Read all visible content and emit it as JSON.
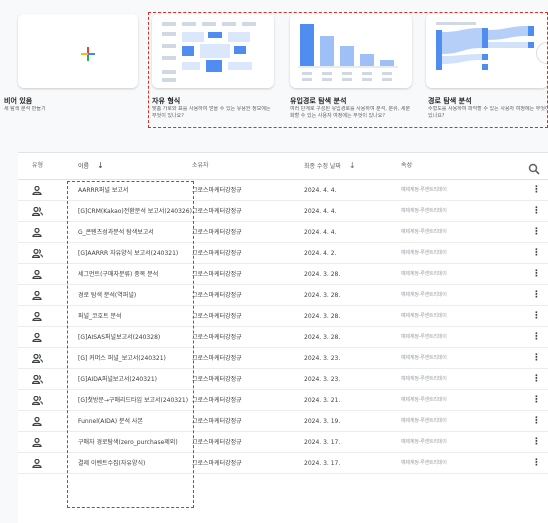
{
  "templates": [
    {
      "title": "비어 있음",
      "desc": "새 탐색 분석 만들기"
    },
    {
      "title": "자유 형식",
      "desc": "맞춤 가로와 표를 사용하여 얻을 수 있는 유용한 정보에는 무엇이 있나요?"
    },
    {
      "title": "유입경로 탐색 분석",
      "desc": "여러 단계로 구성된 유입경로를 사용하여 분석, 분류, 세분화할 수 있는 사용자 여정에는 무엇이 있나요?"
    },
    {
      "title": "경로 탐색 분석",
      "desc": "수형도를 사용하여 파악할 수 있는 사용자 여정에는 무엇이 있나요?"
    }
  ],
  "table": {
    "headers": {
      "type": "유형",
      "name": "이름",
      "owner": "소유자",
      "modified": "최종 수정 날짜",
      "property": "속성"
    },
    "sort_arrow": "↓",
    "rows": [
      {
        "icon": "person-icon",
        "name": "AARRR퍼널 보고서",
        "owner": "그로스마케터강정규",
        "date": "2024. 4. 4.",
        "property": "예제계정-루센트리데이"
      },
      {
        "icon": "people-icon",
        "name": "[G]CRM(Kakao)전환분석 보고서(240326)",
        "owner": "그로스마케터강정규",
        "date": "2024. 4. 4.",
        "property": "예제계정-루센트리데이"
      },
      {
        "icon": "person-icon",
        "name": "G_콘텐츠성과분석 탐색보고서",
        "owner": "그로스마케터강정규",
        "date": "2024. 4. 4.",
        "property": "예제계정-루센트리데이"
      },
      {
        "icon": "people-icon",
        "name": "[G]AARRR 자유양식 보고서(240321)",
        "owner": "그로스마케터강정규",
        "date": "2024. 4. 2.",
        "property": "예제계정-루센트리데이"
      },
      {
        "icon": "person-icon",
        "name": "세그먼트(구매자분류) 중복 분석",
        "owner": "그로스마케터강정규",
        "date": "2024. 3. 28.",
        "property": "예제계정-루센트리데이"
      },
      {
        "icon": "person-icon",
        "name": "경로 탐색 분석(역퍼널)",
        "owner": "그로스마케터강정규",
        "date": "2024. 3. 28.",
        "property": "예제계정-루센트리데이"
      },
      {
        "icon": "person-icon",
        "name": "퍼널_코호트 분석",
        "owner": "그로스마케터강정규",
        "date": "2024. 3. 28.",
        "property": "예제계정-루센트리데이"
      },
      {
        "icon": "person-icon",
        "name": "[G]AISAS퍼널보고서(240328)",
        "owner": "그로스마케터강정규",
        "date": "2024. 3. 28.",
        "property": "예제계정-루센트리데이"
      },
      {
        "icon": "people-icon",
        "name": "[G] 커머스 퍼널_보고서(240321)",
        "owner": "그로스마케터강정규",
        "date": "2024. 3. 23.",
        "property": "예제계정-루센트리데이"
      },
      {
        "icon": "people-icon",
        "name": "[G]AIDA퍼널보고서(240321)",
        "owner": "그로스마케터강정규",
        "date": "2024. 3. 23.",
        "property": "예제계정-루센트리데이"
      },
      {
        "icon": "people-icon",
        "name": "[G]첫방문→구매리드타임 보고서(240321)",
        "owner": "그로스마케터강정규",
        "date": "2024. 3. 21.",
        "property": "예제계정-루센트리데이"
      },
      {
        "icon": "person-icon",
        "name": "Funnel(AIDA) 분석 사본",
        "owner": "그로스마케터강정규",
        "date": "2024. 3. 19.",
        "property": "예제계정-루센트리데이"
      },
      {
        "icon": "person-icon",
        "name": "구매자 경로탐색(zero_purchase제외)",
        "owner": "그로스마케터강정규",
        "date": "2024. 3. 17.",
        "property": "예제계정-루센트리데이"
      },
      {
        "icon": "person-icon",
        "name": "결제 이벤트수집(자유양식)",
        "owner": "그로스마케터강정규",
        "date": "2024. 3. 17.",
        "property": "예제계정-루센트리데이"
      }
    ]
  },
  "colors": {
    "accent": "#4285f4",
    "highlight": "#d93025",
    "plus_red": "#ea4335",
    "plus_yellow": "#fbbc04",
    "plus_green": "#34a853"
  }
}
